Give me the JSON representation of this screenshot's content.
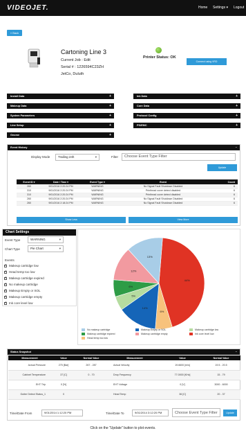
{
  "header": {
    "logo": "VIDEOJET.",
    "nav": [
      "Home",
      "Settings",
      "Logout"
    ]
  },
  "back_label": "« Back",
  "printer": {
    "name": "Cartoning Line 3",
    "current_job": "Current Job : Edit",
    "serial": "Serial # : 1226594C23ZH",
    "location": "JetCo, Duluth",
    "status": "Printer Status: OK",
    "connect_label": "Connect using VRD"
  },
  "sections_left": [
    "Install Data",
    "Makeup Data",
    "System Parameters",
    "Line Setup",
    "Gnome"
  ],
  "sections_right": [
    "Ink Data",
    "Core Data",
    "Protocol Config",
    "PS/EMC"
  ],
  "event_history": {
    "title": "Event History",
    "display_mode_label": "Display Mode",
    "display_mode_value": "Trailing 24h",
    "filter_label": "Filter",
    "filter_placeholder": "Choose Event Type Filter",
    "update_label": "Update",
    "columns": [
      "Event ID",
      "Date / Time",
      "Event Type",
      "Event",
      "Count"
    ],
    "rows": [
      [
        "260",
        "9/01/2016 2:20:24 PM",
        "WARNING",
        "No Signal Fault Shutdown Disabled",
        "6"
      ],
      [
        "310",
        "9/01/2016 2:20:24 PM",
        "WARNING",
        "Printhead cover detect disabled",
        "6"
      ],
      [
        "310",
        "9/01/2016 2:20:24 PM",
        "WARNING",
        "Printhead cover detect disabled",
        "6"
      ],
      [
        "260",
        "9/01/2016 2:20:24 PM",
        "WARNING",
        "No Signal Fault Shutdown Disabled",
        "6"
      ],
      [
        "260",
        "9/01/2016 2:18:24 PM",
        "WARNING",
        "No Signal Fault Shutdown Disabled",
        "6"
      ]
    ],
    "show_less_label": "Show Less",
    "view_more_label": "View More"
  },
  "chart_settings": {
    "title": "Chart Settings",
    "event_type_label": "Event Type",
    "event_type_value": "WARNING",
    "chart_type_label": "Chart Type",
    "chart_type_value": "Pie Chart",
    "events_label": "Events",
    "events": [
      "Makeup cartridge low",
      "Head temp too low",
      "Makeup cartridge expired",
      "No makeup cartridge",
      "Makeup Empty or SOL",
      "Makeup cartridge empty",
      "Ink core level low"
    ]
  },
  "chart_data": {
    "type": "pie",
    "title": "",
    "slices": [
      {
        "label": "Ink core level low",
        "value": 44,
        "color": "#e03324"
      },
      {
        "label": "Head temp too low",
        "value": 6,
        "color": "#f7c27c"
      },
      {
        "label": "Makeup Empty or SOL",
        "value": 14,
        "color": "#1565b8"
      },
      {
        "label": "Makeup cartridge low",
        "value": 5,
        "color": "#b5dca0"
      },
      {
        "label": "Makeup cartridge expired",
        "value": 6,
        "color": "#2e9c46"
      },
      {
        "label": "Makeup cartridge empty",
        "value": 12,
        "color": "#f29aa0"
      },
      {
        "label": "No makeup cartridge",
        "value": 13,
        "color": "#a8cde7"
      }
    ],
    "slice_labels": [
      "44%",
      "6%",
      "14%",
      "5%",
      "6%",
      "12%",
      "13%"
    ],
    "legend": [
      "No makeup cartridge",
      "Makeup Empty or SOL",
      "Makeup cartridge low",
      "Makeup cartridge expired",
      "Makeup cartridge empty",
      "Ink core level low",
      "Head temp too low"
    ]
  },
  "status_snapshot": {
    "title": "Status Snapshot",
    "columns": [
      "Measurement",
      "Value",
      "Normal Value",
      "Measurement",
      "Value",
      "Normal Value"
    ],
    "rows": [
      [
        "Actual Pressure",
        "275 [Bar]",
        "267 - 287",
        "Actual Velocity",
        "19.6600 [m/s]",
        "19.5 - 20.5"
      ],
      [
        "Cabinet Temperature",
        "37 [C]",
        "0 - 70",
        "Drop Frequency",
        "77.0000 [KHz]",
        "15 - 79"
      ],
      [
        "EHT Trip",
        "0 [%]",
        "",
        "EHT Voltage",
        "0 [V]",
        "3000 - 6000"
      ],
      [
        "Gutter Detect Status_1",
        "0",
        "",
        "Head Temp",
        "36 [C]",
        "20 - 37"
      ]
    ],
    "time_from_label": "Time/Date From",
    "time_from_value": "9/01/2014 1:12:20 PM",
    "time_to_label": "Time/Date To",
    "time_to_value": "9/01/2014 3:12:20 PM",
    "filter_placeholder": "Choose Event Type Filter",
    "update_label": "Update",
    "footer": "Click on the \"Update\" button to plot events."
  }
}
